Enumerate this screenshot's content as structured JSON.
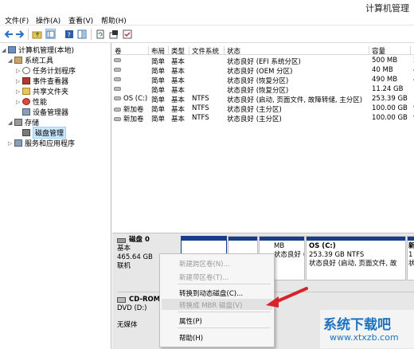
{
  "window": {
    "title": "计算机管理"
  },
  "menu": [
    "文件(F)",
    "操作(A)",
    "查看(V)",
    "帮助(H)"
  ],
  "tree": [
    {
      "label": "计算机管理(本地)",
      "level": 0,
      "arrow": "chevron-down",
      "icon": "computer-icon"
    },
    {
      "label": "系统工具",
      "level": 1,
      "arrow": "chevron-down",
      "icon": "tools-icon"
    },
    {
      "label": "任务计划程序",
      "level": 2,
      "arrow": "chevron-right",
      "icon": "clock-icon"
    },
    {
      "label": "事件查看器",
      "level": 2,
      "arrow": "chevron-right",
      "icon": "event-icon"
    },
    {
      "label": "共享文件夹",
      "level": 2,
      "arrow": "chevron-right",
      "icon": "folder-icon"
    },
    {
      "label": "性能",
      "level": 2,
      "arrow": "chevron-right",
      "icon": "performance-icon"
    },
    {
      "label": "设备管理器",
      "level": 2,
      "arrow": "",
      "icon": "device-icon"
    },
    {
      "label": "存储",
      "level": 1,
      "arrow": "chevron-down",
      "icon": "storage-icon"
    },
    {
      "label": "磁盘管理",
      "level": 2,
      "arrow": "",
      "icon": "disk-icon",
      "selected": true
    },
    {
      "label": "服务和应用程序",
      "level": 1,
      "arrow": "chevron-right",
      "icon": "services-icon"
    }
  ],
  "table": {
    "headers": [
      "卷",
      "布局",
      "类型",
      "文件系统",
      "状态",
      "容量",
      ""
    ],
    "rows": [
      [
        "",
        "简单",
        "基本",
        "",
        "状态良好 (EFI 系统分区)",
        "500 MB",
        "5"
      ],
      [
        "",
        "简单",
        "基本",
        "",
        "状态良好 (OEM 分区)",
        "40 MB",
        "4"
      ],
      [
        "",
        "简单",
        "基本",
        "",
        "状态良好 (恢复分区)",
        "490 MB",
        "4"
      ],
      [
        "",
        "简单",
        "基本",
        "",
        "状态良好 (恢复分区)",
        "11.24 GB",
        "1"
      ],
      [
        "OS (C:)",
        "简单",
        "基本",
        "NTFS",
        "状态良好 (启动, 页面文件, 故障转储, 主分区)",
        "253.39 GB",
        "1"
      ],
      [
        "新加卷",
        "简单",
        "基本",
        "NTFS",
        "状态良好 (主分区)",
        "100.00 GB",
        "9"
      ],
      [
        "新加卷",
        "简单",
        "基本",
        "NTFS",
        "状态良好 (主分区)",
        "100.00 GB",
        "9"
      ]
    ]
  },
  "disk0": {
    "name": "磁盘 0",
    "type": "基本",
    "size": "465.64 GB",
    "status": "联机"
  },
  "cdrom": {
    "name": "CD-ROM",
    "drive": "DVD (D:)",
    "status": "无媒体"
  },
  "partitions": [
    {
      "line1": "",
      "line2": "MB",
      "line3": "状态良好 (恢"
    },
    {
      "line1": "OS  (C:)",
      "line2": "253.39 GB NTFS",
      "line3": "状态良好 (启动, 页面文件, 故"
    },
    {
      "line1": "新",
      "line2": "1",
      "line3": "状"
    }
  ],
  "context_menu": [
    {
      "label": "新建跨区卷(N)...",
      "disabled": true
    },
    {
      "label": "新建带区卷(T)...",
      "disabled": true
    },
    {
      "label": "转换到动态磁盘(C)...",
      "disabled": false
    },
    {
      "label": "转换成 MBR 磁盘(V)",
      "disabled": true
    },
    {
      "label": "属性(P)",
      "disabled": false
    },
    {
      "label": "帮助(H)",
      "disabled": false
    }
  ],
  "watermark": {
    "line1": "系统下载吧",
    "line2": "www.xtxzb.com"
  },
  "colors": {
    "accent": "#1a3c8c",
    "selection": "#cce8ff",
    "arrow": "#d9232b"
  }
}
